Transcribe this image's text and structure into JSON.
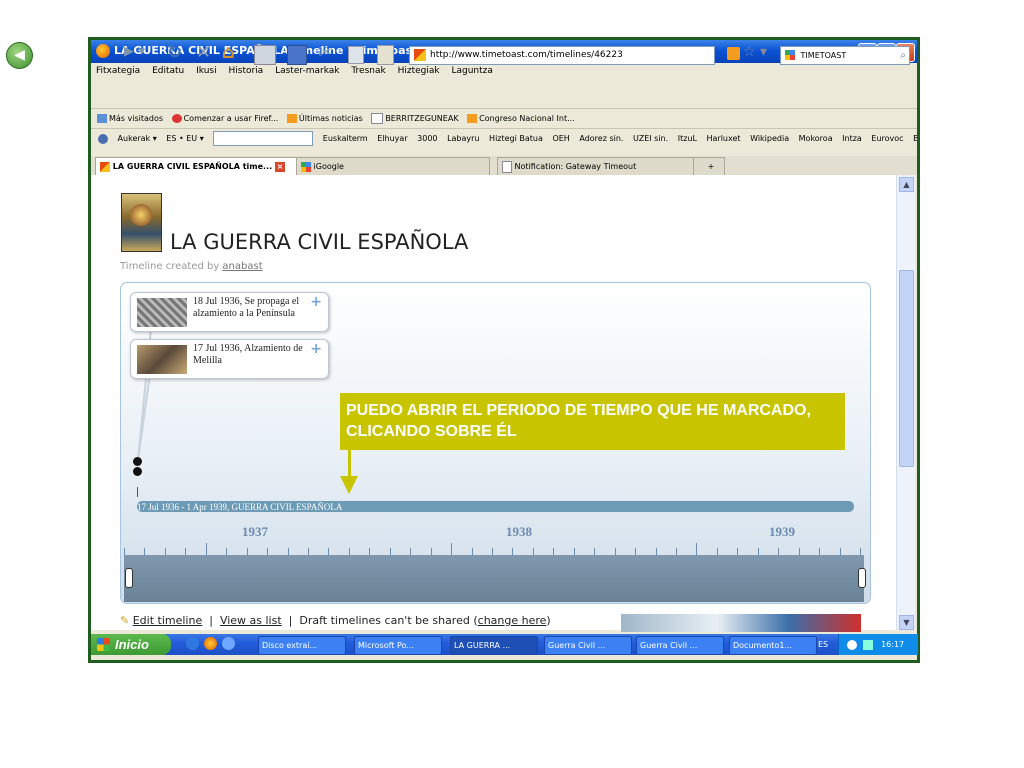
{
  "window": {
    "title": "LA GUERRA CIVIL ESPAÑOLA timeline | Timetoast - Mozilla Firefox",
    "min": "_",
    "max": "□",
    "close": "×"
  },
  "menu": [
    "Fitxategia",
    "Editatu",
    "Ikusi",
    "Historia",
    "Laster-markak",
    "Tresnak",
    "Hiztegiak",
    "Laguntza"
  ],
  "nav": {
    "url": "http://www.timetoast.com/timelines/46223",
    "search_engine": "TIMETOAST"
  },
  "bookmarks": [
    "Más visitados",
    "Comenzar a usar Firef...",
    "Últimas noticias",
    "BERRITZEGUNEAK",
    "Congreso Nacional Int..."
  ],
  "toolbar2": {
    "left_items": [
      "Aukerak ▾",
      "ES • EU ▾"
    ],
    "right_items": [
      "Euskalterm",
      "Elhuyar",
      "3000",
      "Labayru",
      "Hiztegi Batua",
      "OEH",
      "Adorez sin.",
      "UZEI sin.",
      "ItzuL",
      "Harluxet",
      "Wikipedia",
      "Mokoroa",
      "Intza",
      "Eurovoc",
      "Bi"
    ]
  },
  "tabs": [
    "LA GUERRA CIVIL ESPAÑOLA time...",
    "iGoogle",
    "Notification: Gateway Timeout"
  ],
  "page": {
    "title": "LA GUERRA CIVIL ESPAÑOLA",
    "created_prefix": "Timeline created by",
    "author": "anabast"
  },
  "events": [
    "18 Jul 1936, Se propaga el alzamiento a la Península",
    "17 Jul 1936, Alzamiento de Melilla"
  ],
  "callout": "PUEDO ABRIR EL PERIODO DE TIEMPO QUE HE MARCADO, CLICANDO SOBRE ÉL",
  "period_label": "17 Jul 1936 - 1 Apr 1939, GUERRA CIVIL ESPAÑOLA",
  "years": [
    "1937",
    "1938",
    "1939"
  ],
  "footer": {
    "edit": "Edit timeline",
    "view": "View as list",
    "draft": "Draft timelines can't be shared (",
    "change": "change here",
    "close_paren": ")"
  },
  "taskbar": {
    "start": "Inicio",
    "tasks": [
      "Disco extraí...",
      "Microsoft Po...",
      "LA GUERRA ...",
      "Guerra Civil ...",
      "Guerra Civil ...",
      "Documento1..."
    ],
    "lang": "ES",
    "time": "16:17"
  },
  "colors": {
    "callout": "#c8c400",
    "period_bar": "#6d9bb6",
    "title_bar": "#0a54d4"
  }
}
